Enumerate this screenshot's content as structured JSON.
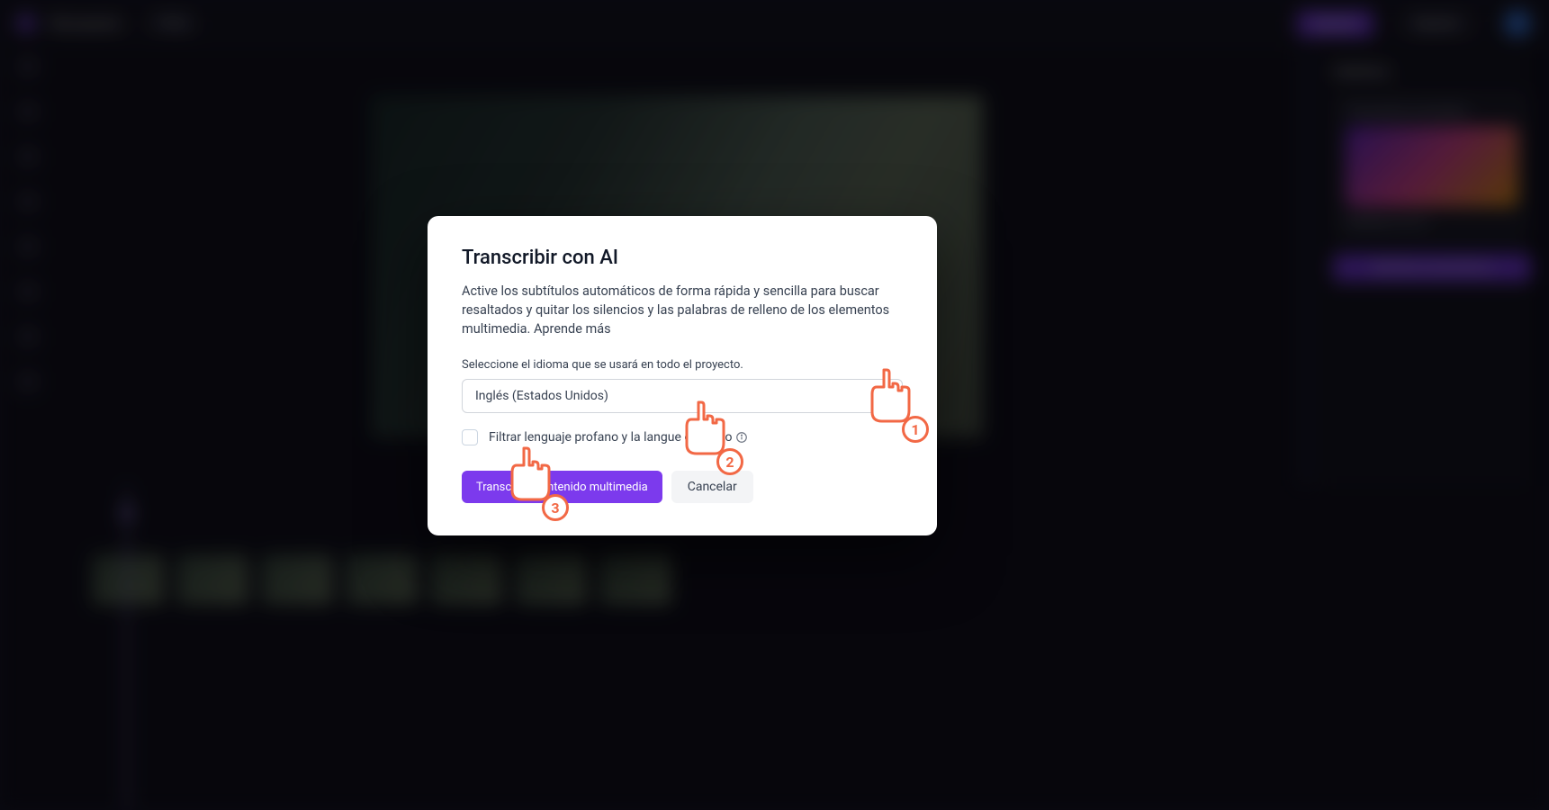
{
  "header": {
    "project_title": "Mi proyecto",
    "resolution": "1080p",
    "upgrade_label": "Upgrade",
    "export_label": "Exportar"
  },
  "right_panel": {
    "heading": "Subtítulos",
    "card_line1": "Transcripción automática",
    "card_line2": "Subtítulos con IA",
    "button": "Subtítulos automáticos"
  },
  "modal": {
    "title": "Transcribir con AI",
    "description": "Active los subtítulos automáticos de forma rápida y sencilla para buscar resaltados y quitar los silencios y las palabras de relleno de los elementos multimedia.",
    "learn_more": "Aprende más",
    "language_label": "Seleccione el idioma que se usará en todo el proyecto.",
    "language_value": "Inglés (Estados Unidos)",
    "filter_label": "Filtrar lenguaje profano y la langue ofensivo",
    "primary_button": "Transcribir contenido multimedia",
    "cancel_button": "Cancelar"
  },
  "annotations": {
    "step1": "1",
    "step2": "2",
    "step3": "3"
  }
}
